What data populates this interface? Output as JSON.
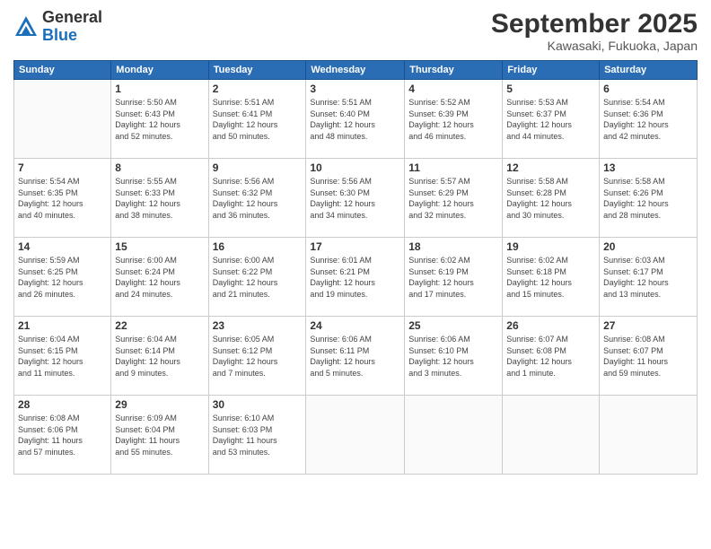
{
  "header": {
    "logo": {
      "general": "General",
      "blue": "Blue"
    },
    "title": "September 2025",
    "location": "Kawasaki, Fukuoka, Japan"
  },
  "calendar": {
    "weekdays": [
      "Sunday",
      "Monday",
      "Tuesday",
      "Wednesday",
      "Thursday",
      "Friday",
      "Saturday"
    ],
    "weeks": [
      [
        {
          "day": "",
          "info": ""
        },
        {
          "day": "1",
          "info": "Sunrise: 5:50 AM\nSunset: 6:43 PM\nDaylight: 12 hours\nand 52 minutes."
        },
        {
          "day": "2",
          "info": "Sunrise: 5:51 AM\nSunset: 6:41 PM\nDaylight: 12 hours\nand 50 minutes."
        },
        {
          "day": "3",
          "info": "Sunrise: 5:51 AM\nSunset: 6:40 PM\nDaylight: 12 hours\nand 48 minutes."
        },
        {
          "day": "4",
          "info": "Sunrise: 5:52 AM\nSunset: 6:39 PM\nDaylight: 12 hours\nand 46 minutes."
        },
        {
          "day": "5",
          "info": "Sunrise: 5:53 AM\nSunset: 6:37 PM\nDaylight: 12 hours\nand 44 minutes."
        },
        {
          "day": "6",
          "info": "Sunrise: 5:54 AM\nSunset: 6:36 PM\nDaylight: 12 hours\nand 42 minutes."
        }
      ],
      [
        {
          "day": "7",
          "info": "Sunrise: 5:54 AM\nSunset: 6:35 PM\nDaylight: 12 hours\nand 40 minutes."
        },
        {
          "day": "8",
          "info": "Sunrise: 5:55 AM\nSunset: 6:33 PM\nDaylight: 12 hours\nand 38 minutes."
        },
        {
          "day": "9",
          "info": "Sunrise: 5:56 AM\nSunset: 6:32 PM\nDaylight: 12 hours\nand 36 minutes."
        },
        {
          "day": "10",
          "info": "Sunrise: 5:56 AM\nSunset: 6:30 PM\nDaylight: 12 hours\nand 34 minutes."
        },
        {
          "day": "11",
          "info": "Sunrise: 5:57 AM\nSunset: 6:29 PM\nDaylight: 12 hours\nand 32 minutes."
        },
        {
          "day": "12",
          "info": "Sunrise: 5:58 AM\nSunset: 6:28 PM\nDaylight: 12 hours\nand 30 minutes."
        },
        {
          "day": "13",
          "info": "Sunrise: 5:58 AM\nSunset: 6:26 PM\nDaylight: 12 hours\nand 28 minutes."
        }
      ],
      [
        {
          "day": "14",
          "info": "Sunrise: 5:59 AM\nSunset: 6:25 PM\nDaylight: 12 hours\nand 26 minutes."
        },
        {
          "day": "15",
          "info": "Sunrise: 6:00 AM\nSunset: 6:24 PM\nDaylight: 12 hours\nand 24 minutes."
        },
        {
          "day": "16",
          "info": "Sunrise: 6:00 AM\nSunset: 6:22 PM\nDaylight: 12 hours\nand 21 minutes."
        },
        {
          "day": "17",
          "info": "Sunrise: 6:01 AM\nSunset: 6:21 PM\nDaylight: 12 hours\nand 19 minutes."
        },
        {
          "day": "18",
          "info": "Sunrise: 6:02 AM\nSunset: 6:19 PM\nDaylight: 12 hours\nand 17 minutes."
        },
        {
          "day": "19",
          "info": "Sunrise: 6:02 AM\nSunset: 6:18 PM\nDaylight: 12 hours\nand 15 minutes."
        },
        {
          "day": "20",
          "info": "Sunrise: 6:03 AM\nSunset: 6:17 PM\nDaylight: 12 hours\nand 13 minutes."
        }
      ],
      [
        {
          "day": "21",
          "info": "Sunrise: 6:04 AM\nSunset: 6:15 PM\nDaylight: 12 hours\nand 11 minutes."
        },
        {
          "day": "22",
          "info": "Sunrise: 6:04 AM\nSunset: 6:14 PM\nDaylight: 12 hours\nand 9 minutes."
        },
        {
          "day": "23",
          "info": "Sunrise: 6:05 AM\nSunset: 6:12 PM\nDaylight: 12 hours\nand 7 minutes."
        },
        {
          "day": "24",
          "info": "Sunrise: 6:06 AM\nSunset: 6:11 PM\nDaylight: 12 hours\nand 5 minutes."
        },
        {
          "day": "25",
          "info": "Sunrise: 6:06 AM\nSunset: 6:10 PM\nDaylight: 12 hours\nand 3 minutes."
        },
        {
          "day": "26",
          "info": "Sunrise: 6:07 AM\nSunset: 6:08 PM\nDaylight: 12 hours\nand 1 minute."
        },
        {
          "day": "27",
          "info": "Sunrise: 6:08 AM\nSunset: 6:07 PM\nDaylight: 11 hours\nand 59 minutes."
        }
      ],
      [
        {
          "day": "28",
          "info": "Sunrise: 6:08 AM\nSunset: 6:06 PM\nDaylight: 11 hours\nand 57 minutes."
        },
        {
          "day": "29",
          "info": "Sunrise: 6:09 AM\nSunset: 6:04 PM\nDaylight: 11 hours\nand 55 minutes."
        },
        {
          "day": "30",
          "info": "Sunrise: 6:10 AM\nSunset: 6:03 PM\nDaylight: 11 hours\nand 53 minutes."
        },
        {
          "day": "",
          "info": ""
        },
        {
          "day": "",
          "info": ""
        },
        {
          "day": "",
          "info": ""
        },
        {
          "day": "",
          "info": ""
        }
      ]
    ]
  }
}
